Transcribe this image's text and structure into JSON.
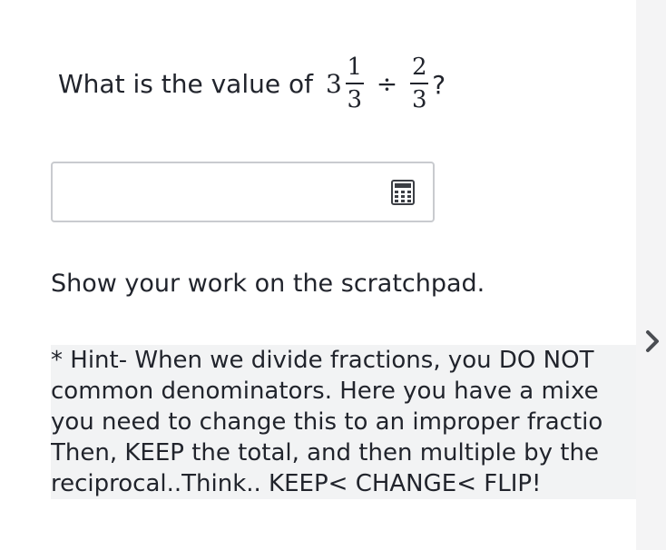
{
  "question": {
    "prefix": "What is the value of",
    "whole": "3",
    "frac1": {
      "numerator": "1",
      "denominator": "3"
    },
    "operator": "÷",
    "frac2": {
      "numerator": "2",
      "denominator": "3"
    },
    "suffix": "?"
  },
  "answer": {
    "value": "",
    "placeholder": ""
  },
  "icons": {
    "calculator": "calculator-icon",
    "expand": "chevron-right-icon"
  },
  "instruction": "Show your work on the scratchpad.",
  "hint": {
    "lines": [
      "* Hint- When we divide fractions, you DO NOT",
      "common denominators.  Here you have a mixe",
      "you need to change this to an improper fractio",
      "Then, KEEP the total, and then multiple by the",
      "reciprocal..Think.. KEEP< CHANGE< FLIP!"
    ]
  },
  "colors": {
    "text": "#21242c",
    "input_border": "#c9cbcf",
    "hint_background": "#f2f3f4",
    "side_panel": "#f4f4f5",
    "chevron": "#4a4d52"
  }
}
